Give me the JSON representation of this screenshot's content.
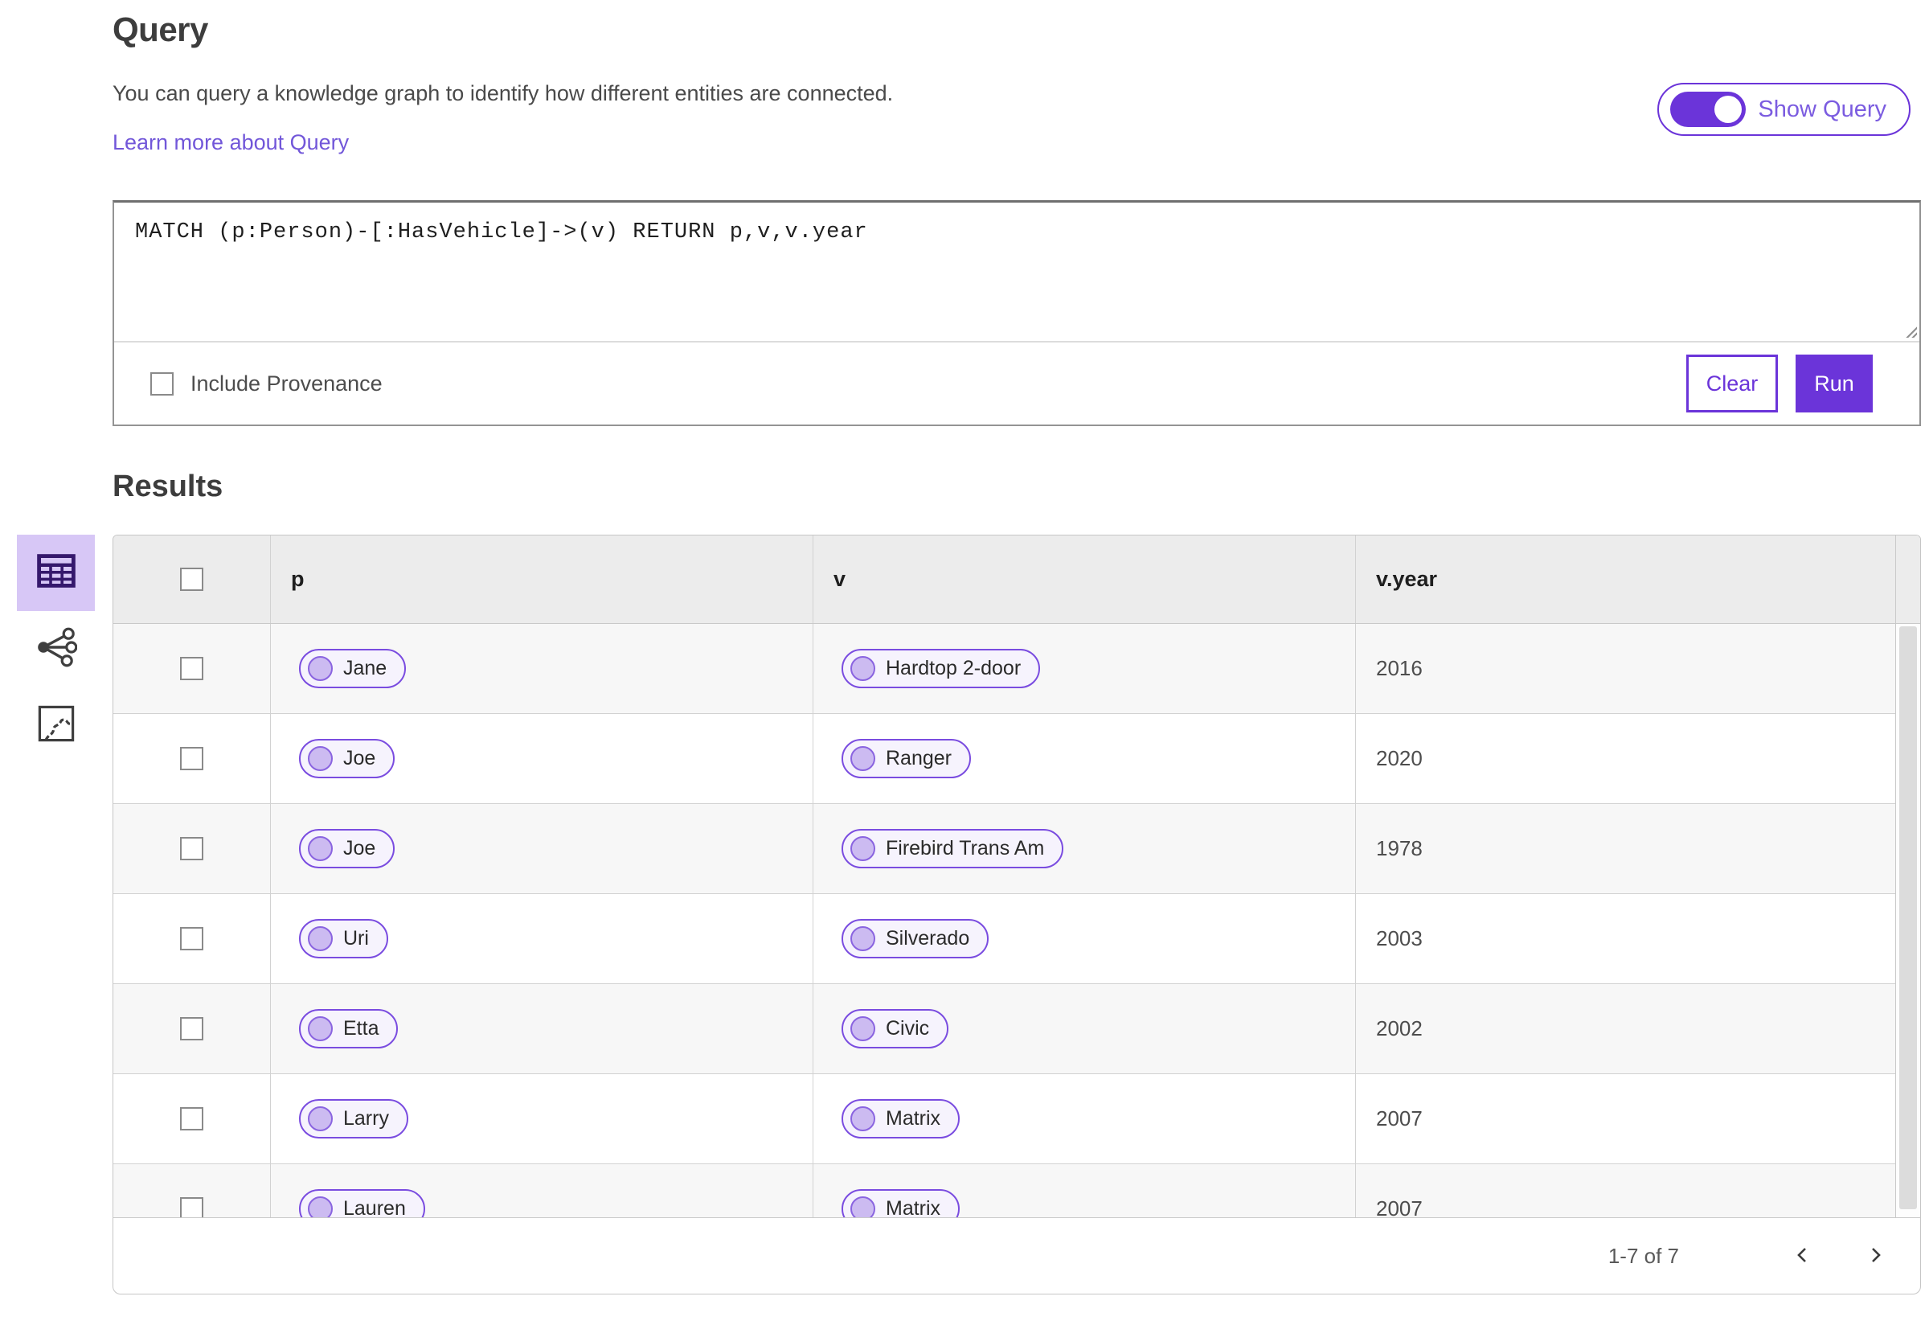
{
  "colors": {
    "accent_purple": "#6b34d9",
    "toggle_text_purple": "#7b5ce0",
    "link_purple": "#7257d9",
    "pill_border_purple": "#7a4ce0",
    "pill_bg": "#f6f3fd",
    "pill_dot_fill": "#ccbbf1",
    "rail_active_bg": "#d7c7f6",
    "table_header_bg": "#ececec",
    "row_alt_bg": "#f7f7f7"
  },
  "header": {
    "title": "Query",
    "description": "You can query a knowledge graph to identify how different entities are connected.",
    "learn_more_label": "Learn more about Query",
    "show_query_label": "Show Query",
    "show_query_on": true
  },
  "query_panel": {
    "query_text": "MATCH (p:Person)-[:HasVehicle]->(v) RETURN p,v,v.year",
    "include_provenance_label": "Include Provenance",
    "include_provenance_checked": false,
    "clear_label": "Clear",
    "run_label": "Run"
  },
  "results": {
    "title": "Results",
    "views": [
      {
        "icon": "table-view-icon",
        "active": true
      },
      {
        "icon": "graph-view-icon",
        "active": false
      },
      {
        "icon": "map-view-icon",
        "active": false
      }
    ],
    "table": {
      "columns": [
        "p",
        "v",
        "v.year"
      ],
      "rows": [
        {
          "p": "Jane",
          "v": "Hardtop 2-door",
          "v_year": "2016"
        },
        {
          "p": "Joe",
          "v": "Ranger",
          "v_year": "2020"
        },
        {
          "p": "Joe",
          "v": "Firebird Trans Am",
          "v_year": "1978"
        },
        {
          "p": "Uri",
          "v": "Silverado",
          "v_year": "2003"
        },
        {
          "p": "Etta",
          "v": "Civic",
          "v_year": "2002"
        },
        {
          "p": "Larry",
          "v": "Matrix",
          "v_year": "2007"
        },
        {
          "p": "Lauren",
          "v": "Matrix",
          "v_year": "2007"
        }
      ]
    },
    "pagination": {
      "range_label": "1-7 of 7"
    }
  }
}
